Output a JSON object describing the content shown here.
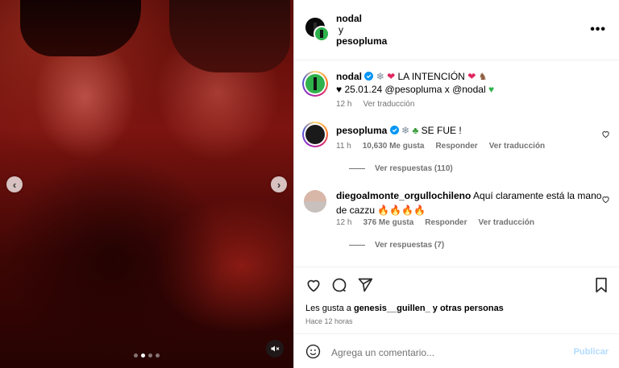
{
  "post": {
    "authors": {
      "first": "nodal",
      "joiner": "y",
      "second": "pesopluma"
    },
    "more_icon": "more-options-icon",
    "media": {
      "prev_icon": "chevron-left-icon",
      "next_icon": "chevron-right-icon",
      "carousel_count": 4,
      "carousel_active": 1,
      "mute_icon": "mute-icon"
    }
  },
  "caption": {
    "username": "nodal",
    "text_main": "LA INTENCIÓN",
    "line2": "25.01.24 @pesopluma x @nodal",
    "time": "12 h",
    "translate": "Ver traducción"
  },
  "comments": [
    {
      "username": "pesopluma",
      "text": "SE FUE !",
      "time": "11 h",
      "likes": "10,630 Me gusta",
      "reply": "Responder",
      "translate": "Ver traducción",
      "view_replies": "Ver respuestas (110)"
    },
    {
      "username": "diegoalmonte_orgullochileno",
      "text": "Aquí claramente está la mano de cazzu",
      "time": "12 h",
      "likes": "376 Me gusta",
      "reply": "Responder",
      "translate": "Ver traducción",
      "view_replies": "Ver respuestas (7)"
    }
  ],
  "actions": {
    "likes_prefix": "Les gusta a",
    "likes_user": "genesis__guillen_",
    "likes_suffix": "y otras personas",
    "time": "Hace 12 horas"
  },
  "composer": {
    "placeholder": "Agrega un comentario...",
    "post_label": "Publicar"
  },
  "colors": {
    "verified": "#0095f6",
    "post_disabled": "#b3dbff",
    "text_secondary": "#737373"
  }
}
